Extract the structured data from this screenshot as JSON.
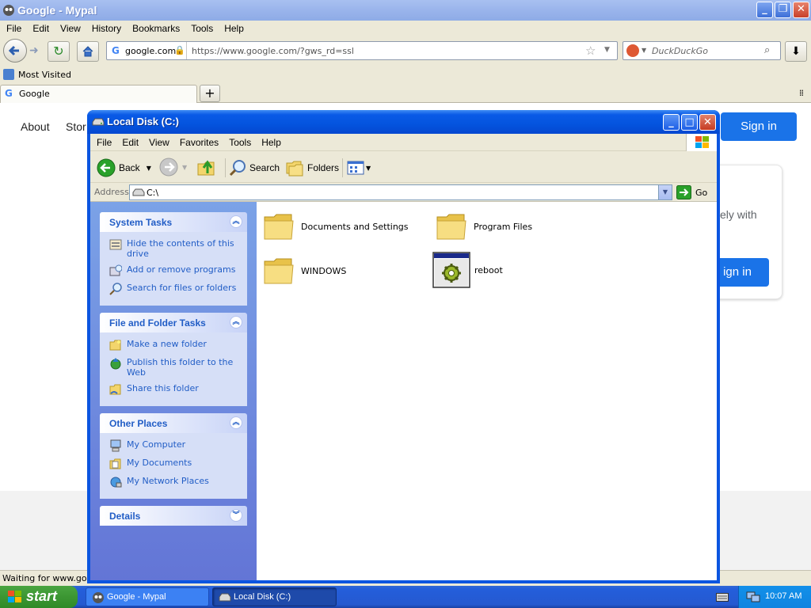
{
  "browser": {
    "title": "Google - Mypal",
    "menu": [
      "File",
      "Edit",
      "View",
      "History",
      "Bookmarks",
      "Tools",
      "Help"
    ],
    "site_identity": "google.com",
    "url": "https://www.google.com/?gws_rd=ssl",
    "search_placeholder": "DuckDuckGo",
    "bookmark": "Most Visited",
    "tab_title": "Google",
    "status": "Waiting for www.goog"
  },
  "google_page": {
    "nav_about": "About",
    "nav_store": "Stor",
    "sign_in_top": "Sign in",
    "card_text": "ely with",
    "card_sign_in": "ign in"
  },
  "explorer": {
    "title": "Local Disk (C:)",
    "menu": [
      "File",
      "Edit",
      "View",
      "Favorites",
      "Tools",
      "Help"
    ],
    "toolbar": {
      "back": "Back",
      "search": "Search",
      "folders": "Folders"
    },
    "address_label": "Address",
    "address_value": "C:\\",
    "go_label": "Go",
    "panels": {
      "system_tasks": {
        "title": "System Tasks",
        "items": [
          "Hide the contents of this drive",
          "Add or remove programs",
          "Search for files or folders"
        ]
      },
      "file_folder_tasks": {
        "title": "File and Folder Tasks",
        "items": [
          "Make a new folder",
          "Publish this folder to the Web",
          "Share this folder"
        ]
      },
      "other_places": {
        "title": "Other Places",
        "items": [
          "My Computer",
          "My Documents",
          "My Network Places"
        ]
      },
      "details": {
        "title": "Details"
      }
    },
    "files": [
      "Documents and Settings",
      "Program Files",
      "WINDOWS",
      "reboot"
    ]
  },
  "taskbar": {
    "start": "start",
    "items": [
      "Google - Mypal",
      "Local Disk (C:)"
    ],
    "clock": "10:07 AM"
  }
}
